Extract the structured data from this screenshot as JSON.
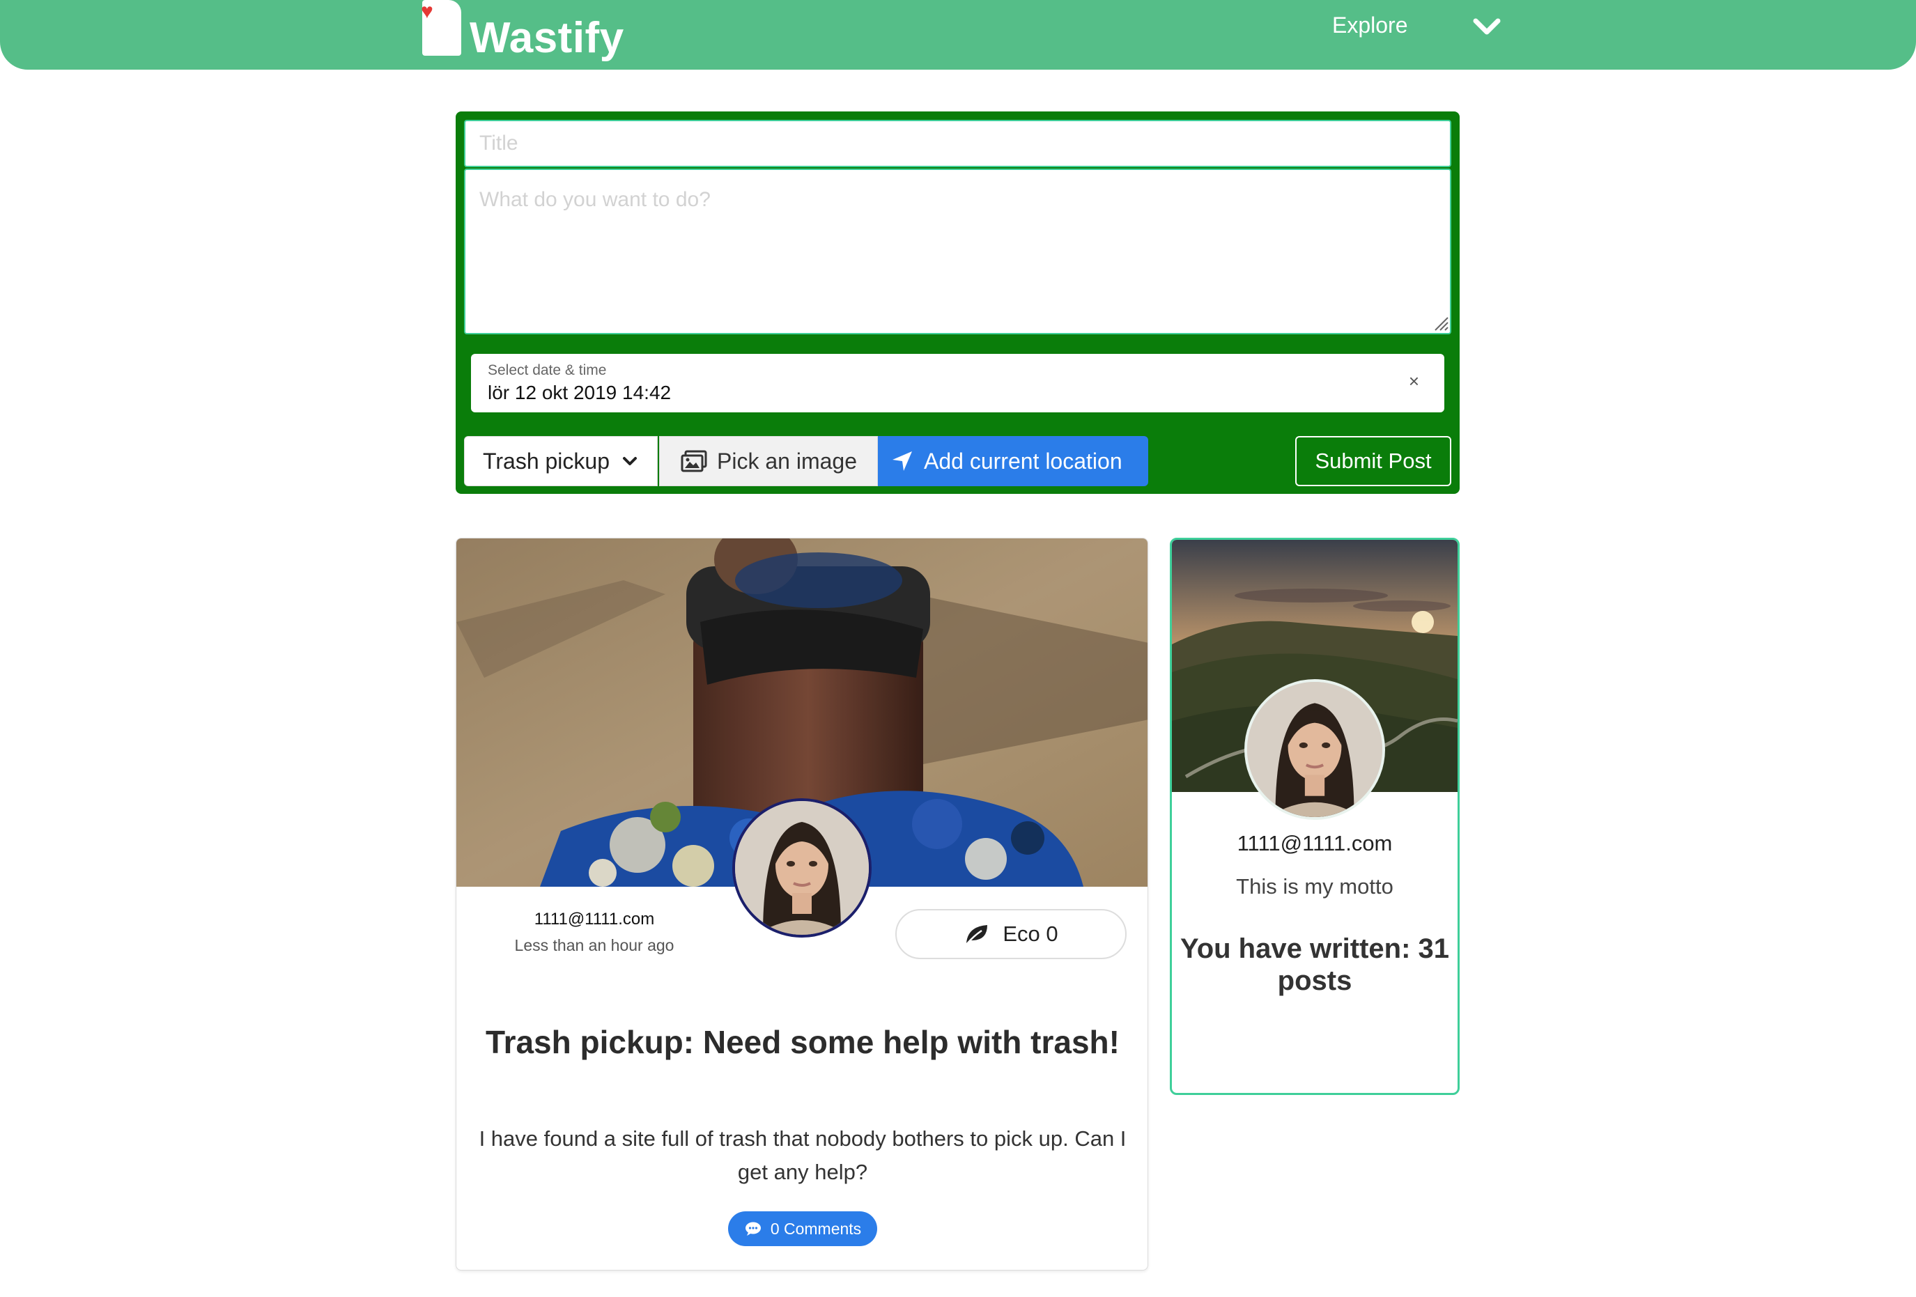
{
  "header": {
    "brand": "Wastify",
    "nav_label": "Explore"
  },
  "post_form": {
    "title_placeholder": "Title",
    "body_placeholder": "What do you want to do?",
    "date_label": "Select date & time",
    "date_value": "lör 12 okt 2019 14:42",
    "clear_symbol": "×",
    "category_selected": "Trash pickup",
    "image_button": "Pick an image",
    "location_button": "Add current location",
    "submit_button": "Submit Post"
  },
  "post": {
    "author_email": "1111@1111.com",
    "time": "Less than an hour ago",
    "eco_label": "Eco 0",
    "title": "Trash pickup: Need some help with trash!",
    "body": "I have found a site full of trash that nobody bothers to pick up. Can I get any help?",
    "comments_label": "0 Comments"
  },
  "profile": {
    "email": "1111@1111.com",
    "motto": "This is my motto",
    "posts_summary": "You have written: 31 posts"
  },
  "colors": {
    "header_green": "#55be88",
    "form_green": "#0a7d0a",
    "accent_teal": "#3fcf9a",
    "primary_blue": "#2b7de9",
    "avatar_border": "#1b1f6b"
  }
}
